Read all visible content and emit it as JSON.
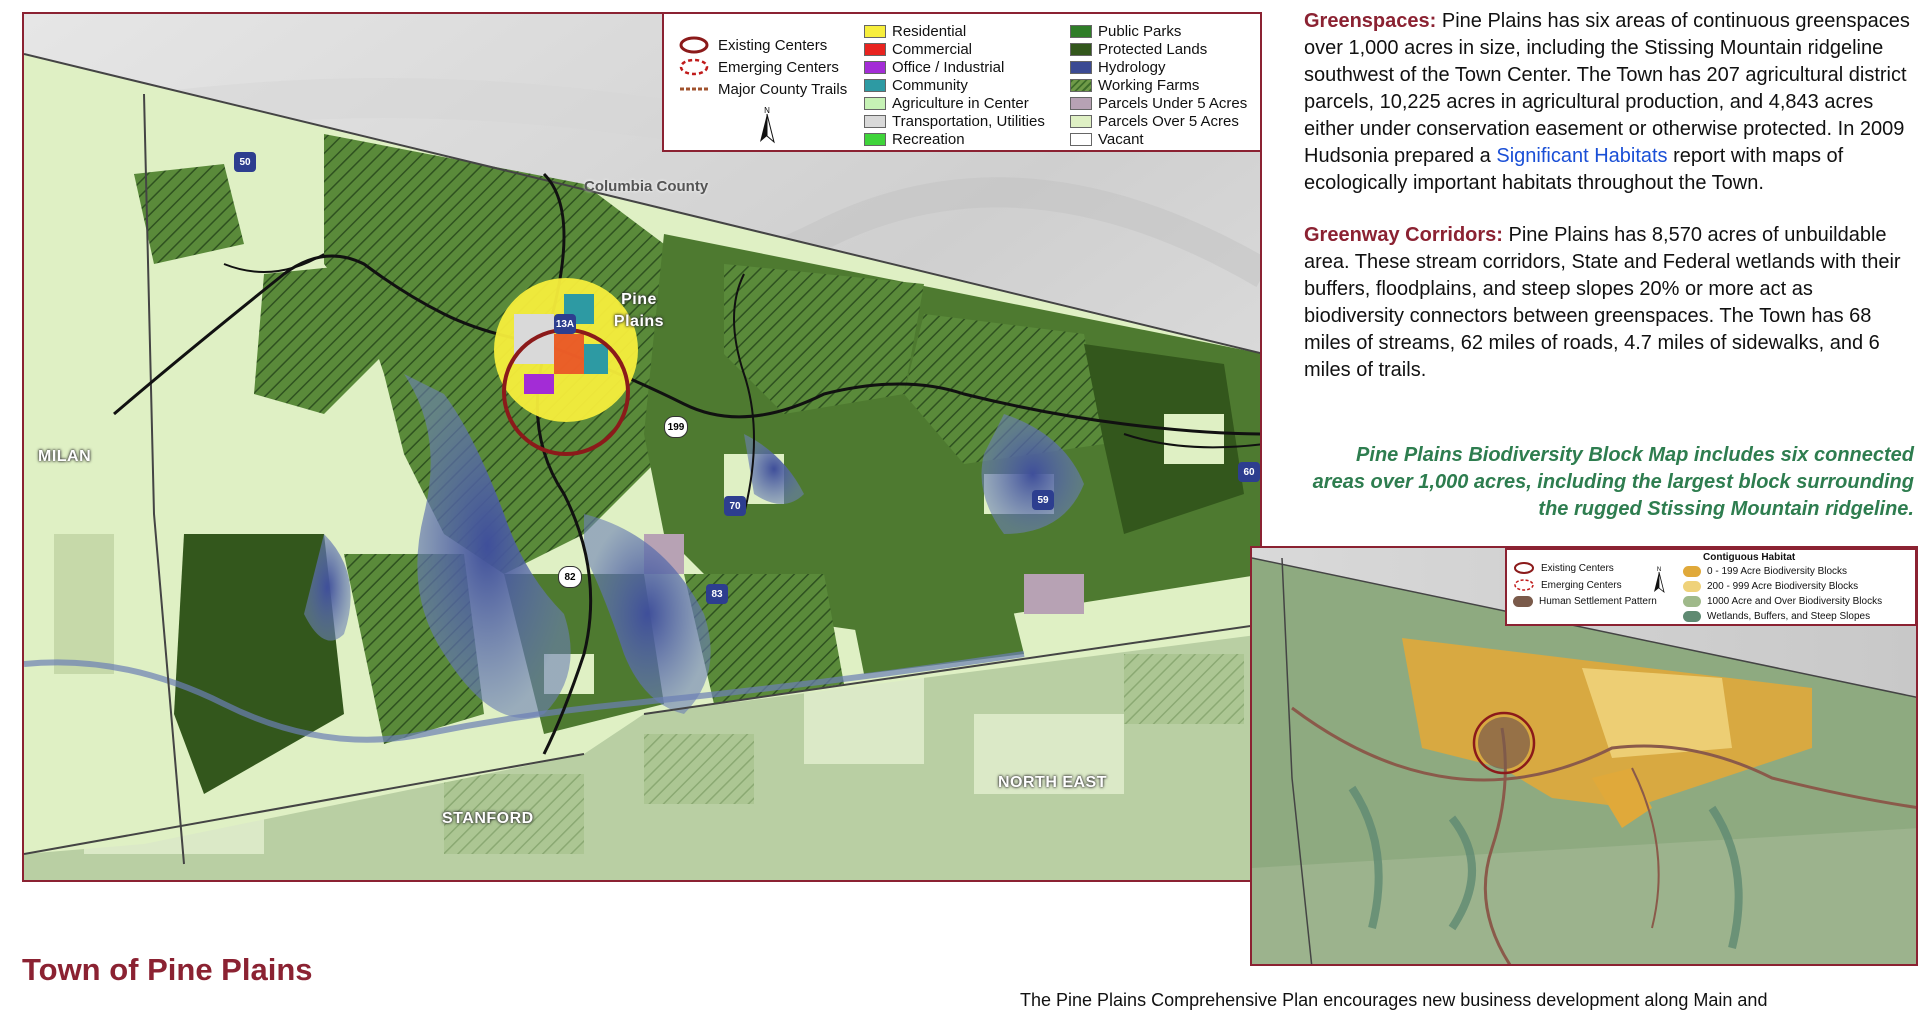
{
  "main_map": {
    "legend": {
      "centers": [
        {
          "label": "Existing Centers",
          "icon": "solid-red-ring"
        },
        {
          "label": "Emerging Centers",
          "icon": "dashed-red-ring"
        },
        {
          "label": "Major County Trails",
          "icon": "dashed-brown-line"
        }
      ],
      "land_use_col1": [
        {
          "label": "Residential",
          "color": "#f7ee3c"
        },
        {
          "label": "Commercial",
          "color": "#e8231f"
        },
        {
          "label": "Office / Industrial",
          "color": "#a32cd6"
        },
        {
          "label": "Community",
          "color": "#2d9aa3"
        },
        {
          "label": "Agriculture in Center",
          "color": "#c6f2b5"
        },
        {
          "label": "Transportation, Utilities",
          "color": "#d9d9d9"
        },
        {
          "label": "Recreation",
          "color": "#3fd43a"
        }
      ],
      "land_use_col2": [
        {
          "label": "Public Parks",
          "color": "#2f7d28"
        },
        {
          "label": "Protected Lands",
          "color": "#33571c"
        },
        {
          "label": "Hydrology",
          "color": "#3b4a93"
        },
        {
          "label": "Working Farms",
          "color": "hatch"
        },
        {
          "label": "Parcels Under 5 Acres",
          "color": "#b7a2b4"
        },
        {
          "label": "Parcels Over 5 Acres",
          "color": "#dff0c4"
        },
        {
          "label": "Vacant",
          "color": "#ffffff"
        }
      ]
    },
    "labels": {
      "county": "Columbia County",
      "milan": "MILAN",
      "stanford": "STANFORD",
      "north_east": "NORTH EAST",
      "center": "Pine\nPlains"
    },
    "routes": [
      "50",
      "13A",
      "199",
      "70",
      "59",
      "60",
      "83",
      "82"
    ]
  },
  "greenspaces": {
    "heading": "Greenspaces:",
    "body_1": " Pine Plains has six areas of continuous greenspaces over 1,000 acres in size, including the Stissing Mountain ridgeline southwest of the Town Center. The Town has 207 agricultural district parcels, 10,225 acres in agricultural production, and 4,843 acres either under conservation easement or otherwise protected. In 2009 Hudsonia prepared a ",
    "link": "Significant Habitats",
    "body_2": " report with maps of ecologically important habitats throughout the Town."
  },
  "greenway": {
    "heading": "Greenway Corridors:",
    "body": " Pine Plains has 8,570 acres of unbuildable area. These stream corridors, State and Federal wetlands with their buffers, floodplains, and steep slopes 20% or more act as biodiversity connectors between greenspaces. The Town has 68 miles of streams, 62 miles of roads, 4.7 miles of sidewalks, and 6 miles of trails."
  },
  "caption": "Pine Plains Biodiversity Block Map includes six connected areas over 1,000 acres, including the largest block surrounding the rugged Stissing Mountain ridgeline.",
  "inset_legend": {
    "centers": [
      {
        "label": "Existing Centers"
      },
      {
        "label": "Emerging Centers"
      },
      {
        "label": "Human Settlement Pattern"
      }
    ],
    "habitat_title": "Contiguous Habitat",
    "habitat": [
      {
        "label": "0 - 199 Acre Biodiversity Blocks",
        "color": "#e0a93a"
      },
      {
        "label": "200 - 999 Acre Biodiversity Blocks",
        "color": "#efd27a"
      },
      {
        "label": "1000 Acre and Over Biodiversity Blocks",
        "color": "#9fb98a"
      },
      {
        "label": "Wetlands, Buffers, and Steep Slopes",
        "color": "#5f8a72"
      }
    ]
  },
  "footer": {
    "title": "Town of Pine Plains",
    "text": "The Pine Plains Comprehensive Plan encourages new business development along Main and"
  }
}
